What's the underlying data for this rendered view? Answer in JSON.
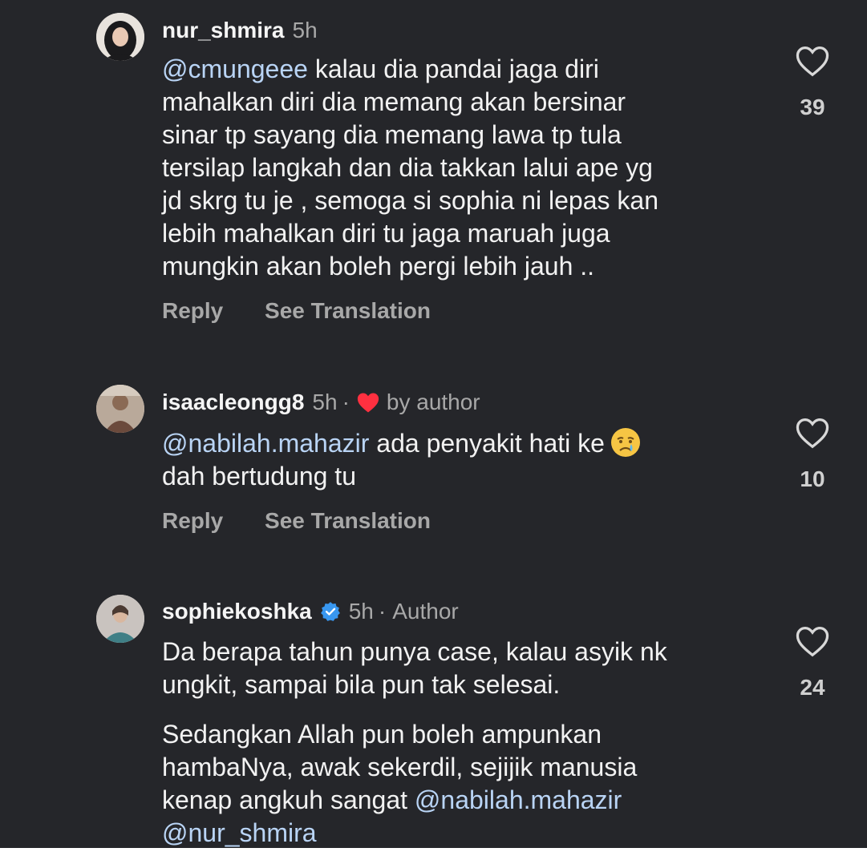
{
  "comments": [
    {
      "username": "nur_shmira",
      "time": "5h",
      "body_mention": "@cmungeee",
      "body_lines": [
        " kalau dia pandai jaga diri",
        "mahalkan diri dia memang akan bersinar",
        "sinar tp sayang dia memang lawa tp tula",
        "tersilap langkah dan dia takkan lalui ape yg",
        "jd skrg tu je , semoga si sophia ni lepas kan",
        "lebih mahalkan diri tu jaga maruah juga",
        "mungkin akan boleh pergi lebih jauh .."
      ],
      "reply_label": "Reply",
      "translate_label": "See Translation",
      "likes": "39"
    },
    {
      "username": "isaacleongg8",
      "time": "5h",
      "dot": "·",
      "liked_label": "by author",
      "body_mention": "@nabilah.mahazir",
      "body_line1": " ada penyakit hati ke",
      "body_line2": "dah bertudung tu",
      "emoji": "crying-face",
      "reply_label": "Reply",
      "translate_label": "See Translation",
      "likes": "10"
    },
    {
      "username": "sophiekoshka",
      "time": "5h",
      "dot": "·",
      "tag": "Author",
      "para1_line1": "Da berapa tahun punya case, kalau asyik nk",
      "para1_line2": "ungkit, sampai bila pun tak selesai.",
      "para2_line1": "Sedangkan Allah pun boleh ampunkan",
      "para2_line2": "hambaNya, awak sekerdil, sejijik manusia",
      "para2_line3": "kenap angkuh sangat ",
      "para2_mention1": "@nabilah.mahazir",
      "para2_mention2": "@nur_shmira",
      "likes": "24"
    }
  ],
  "colors": {
    "background": "#25262a",
    "text": "#f2f2f2",
    "muted": "#a8a8a8",
    "mention": "#b9d4f5",
    "verified": "#3897f0",
    "heart_red": "#ff3040"
  }
}
